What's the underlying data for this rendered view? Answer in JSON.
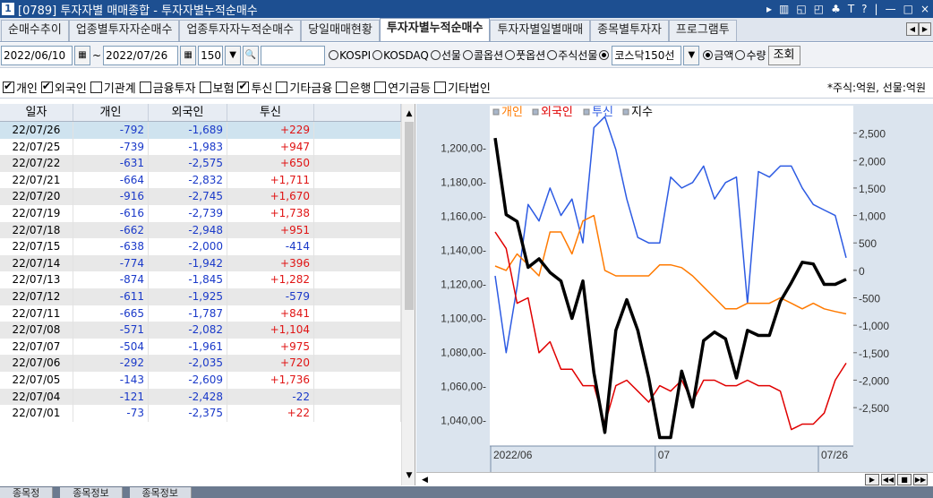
{
  "window": {
    "number": "1",
    "title": "[0789] 투자자별 매매종합 - 투자자별누적순매수",
    "buttons": [
      "▸",
      "▥",
      "◱",
      "◰",
      "♣",
      "T",
      "?",
      "|",
      "—",
      "□",
      "×"
    ]
  },
  "tabs": [
    {
      "label": "순매수추이",
      "active": false
    },
    {
      "label": "업종별투자자순매수",
      "active": false
    },
    {
      "label": "업종투자자누적순매수",
      "active": false
    },
    {
      "label": "당일매매현황",
      "active": false
    },
    {
      "label": "투자자별누적순매수",
      "active": true
    },
    {
      "label": "투자자별일별매매",
      "active": false
    },
    {
      "label": "종목별투자자",
      "active": false
    },
    {
      "label": "프로그램투",
      "active": false
    }
  ],
  "tab_nav": [
    "◀",
    "▶"
  ],
  "toolbar": {
    "start_date": "2022/06/10",
    "date_sep": "~",
    "end_date": "2022/07/26",
    "count": "150",
    "search_value": "",
    "markets": [
      {
        "label": "KOSPI",
        "selected": false
      },
      {
        "label": "KOSDAQ",
        "selected": false
      },
      {
        "label": "선물",
        "selected": false
      },
      {
        "label": "콜옵션",
        "selected": false
      },
      {
        "label": "풋옵션",
        "selected": false
      },
      {
        "label": "주식선물",
        "selected": false
      },
      {
        "label": "",
        "selected": true
      }
    ],
    "market_select": "코스닥150선",
    "units": [
      {
        "label": "금액",
        "selected": true
      },
      {
        "label": "수량",
        "selected": false
      }
    ],
    "query_label": "조회"
  },
  "filters": [
    {
      "label": "개인",
      "checked": true
    },
    {
      "label": "외국인",
      "checked": true
    },
    {
      "label": "기관계",
      "checked": false
    },
    {
      "label": "금융투자",
      "checked": false
    },
    {
      "label": "보험",
      "checked": false
    },
    {
      "label": "투신",
      "checked": true
    },
    {
      "label": "기타금융",
      "checked": false
    },
    {
      "label": "은행",
      "checked": false
    },
    {
      "label": "연기금등",
      "checked": false
    },
    {
      "label": "기타법인",
      "checked": false
    }
  ],
  "unit_note": "*주식:억원, 선물:억원",
  "table": {
    "headers": [
      "일자",
      "개인",
      "외국인",
      "투신",
      ""
    ],
    "rows": [
      [
        "22/07/26",
        "-792",
        "-1,689",
        "+229"
      ],
      [
        "22/07/25",
        "-739",
        "-1,983",
        "+947"
      ],
      [
        "22/07/22",
        "-631",
        "-2,575",
        "+650"
      ],
      [
        "22/07/21",
        "-664",
        "-2,832",
        "+1,711"
      ],
      [
        "22/07/20",
        "-916",
        "-2,745",
        "+1,670"
      ],
      [
        "22/07/19",
        "-616",
        "-2,739",
        "+1,738"
      ],
      [
        "22/07/18",
        "-662",
        "-2,948",
        "+951"
      ],
      [
        "22/07/15",
        "-638",
        "-2,000",
        "-414"
      ],
      [
        "22/07/14",
        "-774",
        "-1,942",
        "+396"
      ],
      [
        "22/07/13",
        "-874",
        "-1,845",
        "+1,282"
      ],
      [
        "22/07/12",
        "-611",
        "-1,925",
        "-579"
      ],
      [
        "22/07/11",
        "-665",
        "-1,787",
        "+841"
      ],
      [
        "22/07/08",
        "-571",
        "-2,082",
        "+1,104"
      ],
      [
        "22/07/07",
        "-504",
        "-1,961",
        "+975"
      ],
      [
        "22/07/06",
        "-292",
        "-2,035",
        "+720"
      ],
      [
        "22/07/05",
        "-143",
        "-2,609",
        "+1,736"
      ],
      [
        "22/07/04",
        "-121",
        "-2,428",
        "-22"
      ],
      [
        "22/07/01",
        "-73",
        "-2,375",
        "+22"
      ]
    ]
  },
  "bottom_tabs": [
    "종목정",
    "종목정보",
    "종목정보"
  ],
  "colors": {
    "title_bar": "#1d4f91",
    "individual": "#ff7a00",
    "foreign": "#e00000",
    "trust": "#2d5be3",
    "index": "#000000",
    "chart_bg": "#dbe4ee",
    "plot_bg": "#ffffff"
  },
  "chart_data": {
    "type": "line",
    "legend": [
      {
        "name": "개인",
        "color": "#ff7a00"
      },
      {
        "name": "외국인",
        "color": "#e00000"
      },
      {
        "name": "투신",
        "color": "#2d5be3"
      },
      {
        "name": "지수",
        "color": "#000000"
      }
    ],
    "legend_position": "top-left",
    "x_labels": [
      "2022/06",
      "07",
      "07/26"
    ],
    "y_left_ticks": [
      1040,
      1060,
      1080,
      1100,
      1120,
      1140,
      1160,
      1180,
      1200
    ],
    "y_left_tick_labels": [
      "1,040,00-",
      "1,060,00-",
      "1,080,00-",
      "1,100,00-",
      "1,120,00-",
      "1,140,00-",
      "1,160,00-",
      "1,180,00-",
      "1,200,00-"
    ],
    "y_left_range": [
      1025,
      1225
    ],
    "y_right_ticks": [
      -2500,
      -2000,
      -1500,
      -1000,
      -500,
      0,
      500,
      1000,
      1500,
      2000,
      2500
    ],
    "y_right_tick_labels": [
      "-2,500",
      "-2,000",
      "-1,500",
      "-1,000",
      "-500",
      "0",
      "500",
      "1,000",
      "1,500",
      "2,000",
      "2,500"
    ],
    "y_right_range": [
      -3200,
      3000
    ],
    "grid": false,
    "series": [
      {
        "name": "지수",
        "axis": "left",
        "values": [
          1206,
          1161,
          1157,
          1130,
          1135,
          1127,
          1122,
          1100,
          1122,
          1068,
          1033,
          1093,
          1111,
          1093,
          1065,
          1030,
          1030,
          1069,
          1048,
          1087,
          1092,
          1088,
          1065,
          1093,
          1090,
          1090,
          1110,
          1121,
          1133,
          1132,
          1120,
          1120,
          1123
        ]
      },
      {
        "name": "개인",
        "axis": "right",
        "values": [
          80,
          0,
          300,
          100,
          -100,
          700,
          700,
          300,
          900,
          1000,
          0,
          -100,
          -100,
          -100,
          -100,
          100,
          100,
          50,
          -100,
          -300,
          -500,
          -700,
          -700,
          -600,
          -600,
          -600,
          -500,
          -600,
          -700,
          -600,
          -700,
          -750,
          -792
        ]
      },
      {
        "name": "외국인",
        "axis": "right",
        "values": [
          700,
          400,
          -600,
          -500,
          -1500,
          -1300,
          -1800,
          -1800,
          -2100,
          -2100,
          -2800,
          -2100,
          -2000,
          -2200,
          -2400,
          -2100,
          -2200,
          -2000,
          -2400,
          -2000,
          -2000,
          -2100,
          -2100,
          -2000,
          -2100,
          -2100,
          -2200,
          -2900,
          -2800,
          -2800,
          -2600,
          -2000,
          -1689
        ]
      },
      {
        "name": "투신",
        "axis": "right",
        "values": [
          -100,
          -1500,
          -300,
          1200,
          900,
          1500,
          1000,
          1300,
          500,
          2600,
          2800,
          2200,
          1300,
          600,
          500,
          500,
          1700,
          1500,
          1600,
          1900,
          1300,
          1600,
          1700,
          -600,
          1800,
          1700,
          1900,
          1900,
          1500,
          1200,
          1100,
          1000,
          229
        ]
      }
    ]
  }
}
